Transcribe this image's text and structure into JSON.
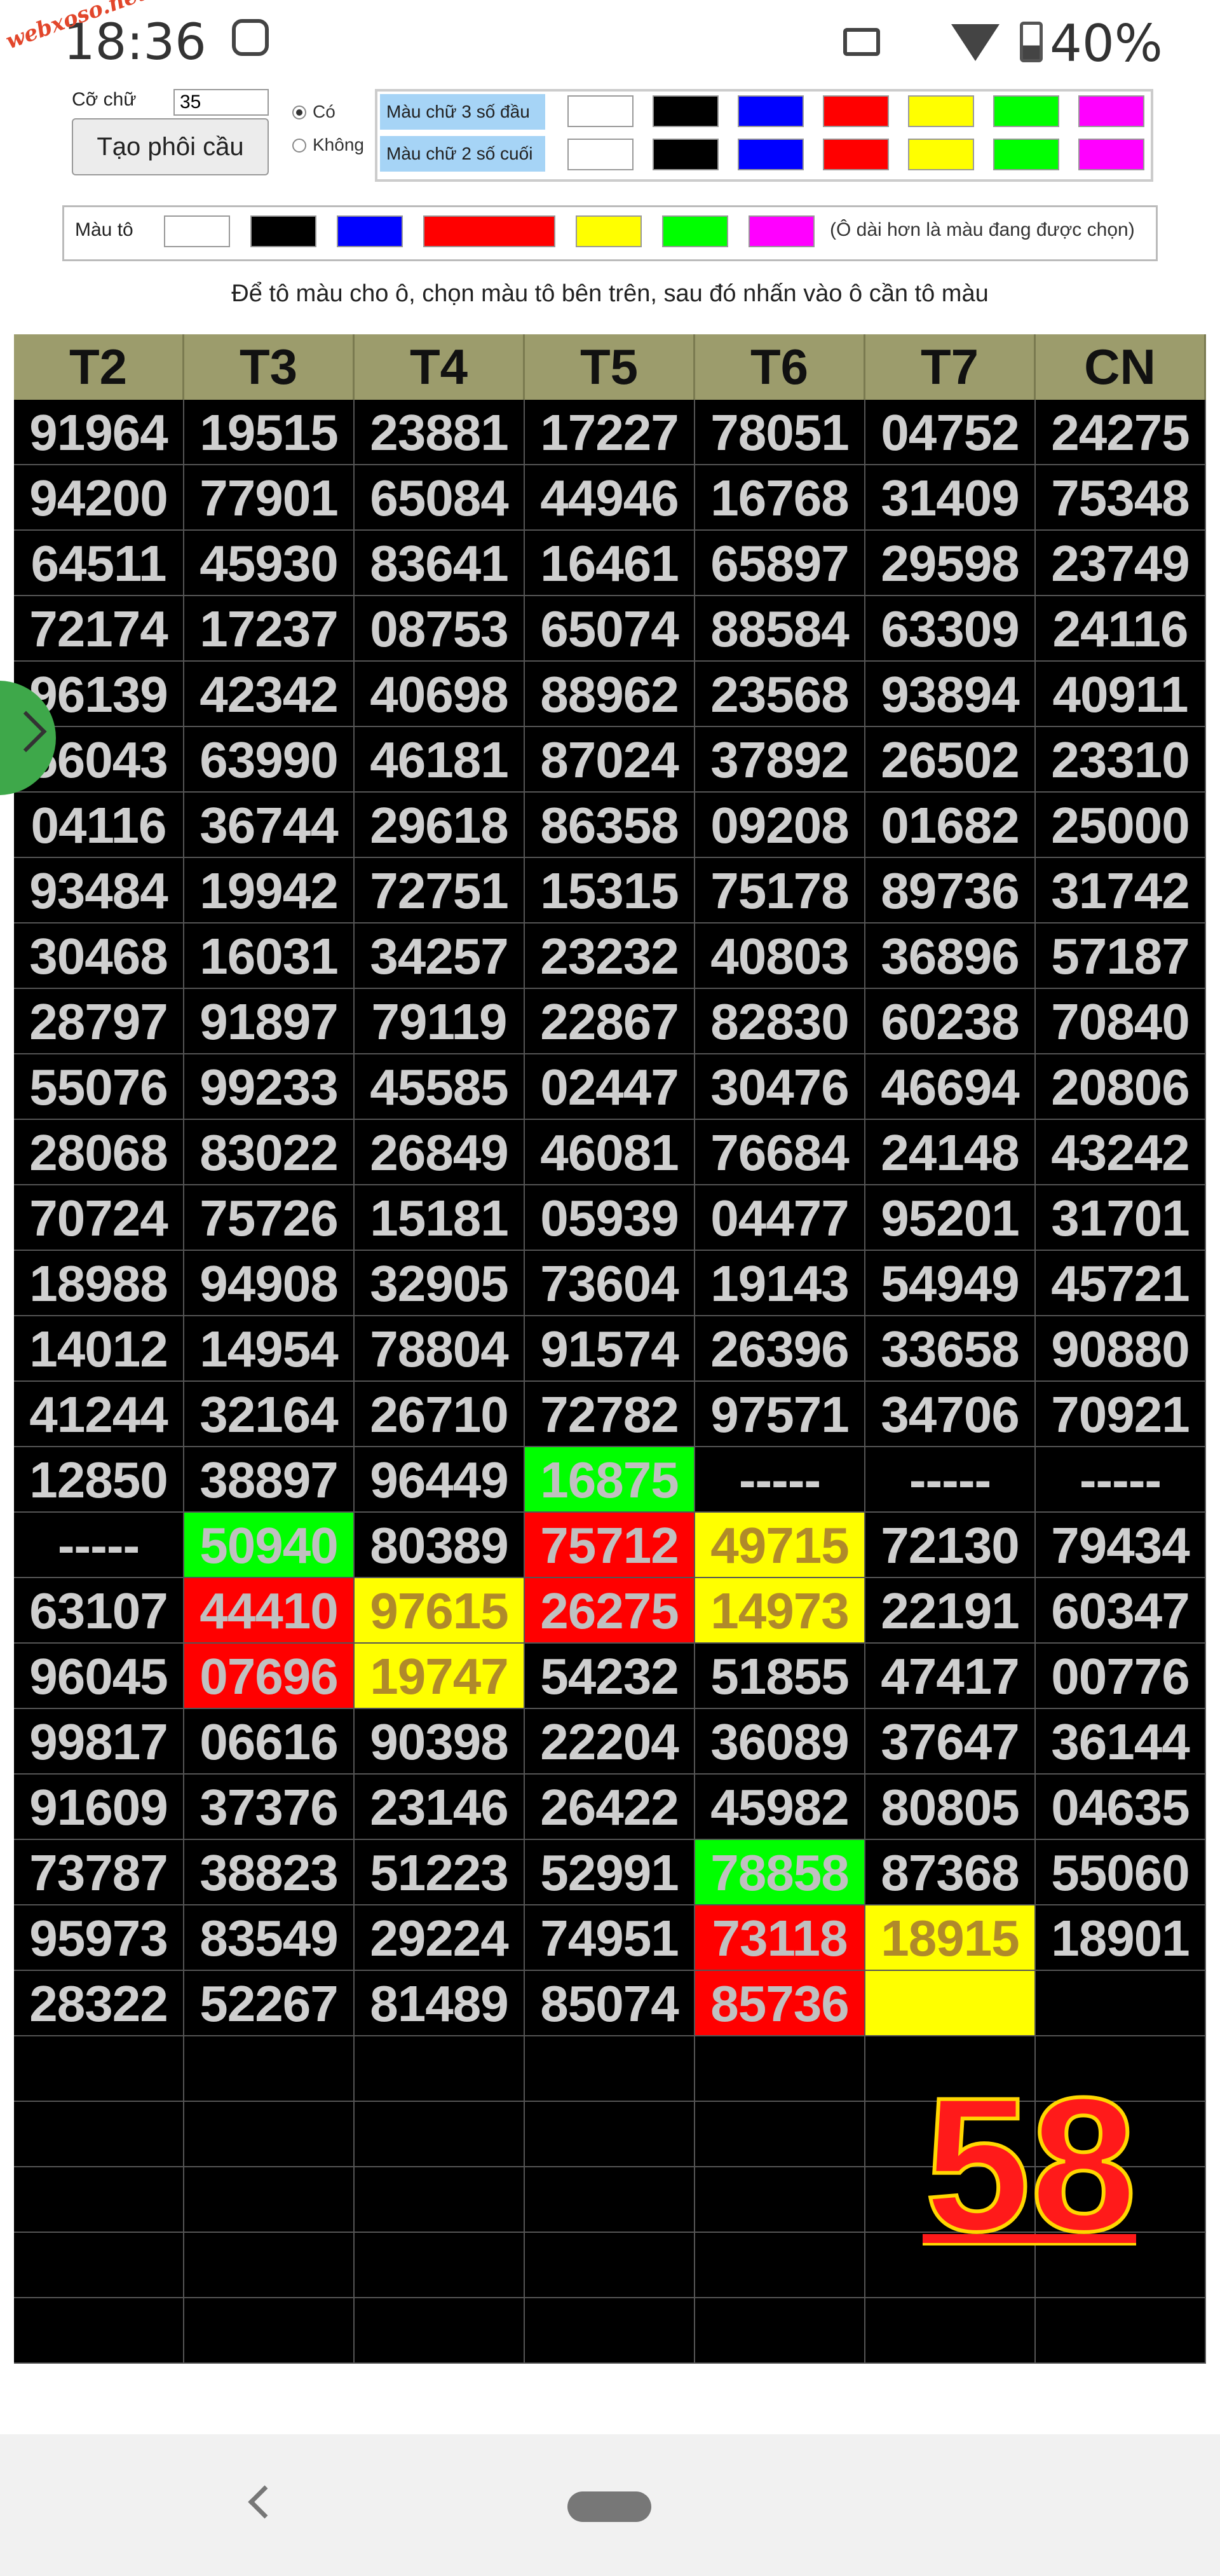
{
  "status_bar": {
    "time": "18:36",
    "watermark": "webxoso.net",
    "battery": "40%"
  },
  "controls": {
    "font_size_label": "Cỡ chữ",
    "font_size_value": "35",
    "create_button": "Tạo phôi cầu",
    "radio_yes": "Có",
    "radio_no": "Không",
    "color_row_1_label": "Màu chữ 3 số đầu",
    "color_row_2_label": "Màu chữ 2 số cuối",
    "fill_label": "Màu tô",
    "fill_note": "(Ô dài hơn là màu đang được chọn)",
    "instruction": "Để tô màu cho ô, chọn màu tô bên trên, sau đó nhấn vào ô cần tô màu",
    "palette": [
      "#ffffff",
      "#000000",
      "#0000ff",
      "#ff0000",
      "#ffff00",
      "#00ff00",
      "#ff00ff"
    ]
  },
  "grid": {
    "headers": [
      "T2",
      "T3",
      "T4",
      "T5",
      "T6",
      "T7",
      "CN"
    ],
    "rows": [
      [
        "91964",
        "19515",
        "23881",
        "17227",
        "78051",
        "04752",
        "24275"
      ],
      [
        "94200",
        "77901",
        "65084",
        "44946",
        "16768",
        "31409",
        "75348"
      ],
      [
        "64511",
        "45930",
        "83641",
        "16461",
        "65897",
        "29598",
        "23749"
      ],
      [
        "72174",
        "17237",
        "08753",
        "65074",
        "88584",
        "63309",
        "24116"
      ],
      [
        "96139",
        "42342",
        "40698",
        "88962",
        "23568",
        "93894",
        "40911"
      ],
      [
        "56043",
        "63990",
        "46181",
        "87024",
        "37892",
        "26502",
        "23310"
      ],
      [
        "04116",
        "36744",
        "29618",
        "86358",
        "09208",
        "01682",
        "25000"
      ],
      [
        "93484",
        "19942",
        "72751",
        "15315",
        "75178",
        "89736",
        "31742"
      ],
      [
        "30468",
        "16031",
        "34257",
        "23232",
        "40803",
        "36896",
        "57187"
      ],
      [
        "28797",
        "91897",
        "79119",
        "22867",
        "82830",
        "60238",
        "70840"
      ],
      [
        "55076",
        "99233",
        "45585",
        "02447",
        "30476",
        "46694",
        "20806"
      ],
      [
        "28068",
        "83022",
        "26849",
        "46081",
        "76684",
        "24148",
        "43242"
      ],
      [
        "70724",
        "75726",
        "15181",
        "05939",
        "04477",
        "95201",
        "31701"
      ],
      [
        "18988",
        "94908",
        "32905",
        "73604",
        "19143",
        "54949",
        "45721"
      ],
      [
        "14012",
        "14954",
        "78804",
        "91574",
        "26396",
        "33658",
        "90880"
      ],
      [
        "41244",
        "32164",
        "26710",
        "72782",
        "97571",
        "34706",
        "70921"
      ],
      [
        "12850",
        "38897",
        "96449",
        "16875",
        "-----",
        "-----",
        "-----"
      ],
      [
        "-----",
        "50940",
        "80389",
        "75712",
        "49715",
        "72130",
        "79434"
      ],
      [
        "63107",
        "44410",
        "97615",
        "26275",
        "14973",
        "22191",
        "60347"
      ],
      [
        "96045",
        "07696",
        "19747",
        "54232",
        "51855",
        "47417",
        "00776"
      ],
      [
        "99817",
        "06616",
        "90398",
        "22204",
        "36089",
        "37647",
        "36144"
      ],
      [
        "91609",
        "37376",
        "23146",
        "26422",
        "45982",
        "80805",
        "04635"
      ],
      [
        "73787",
        "38823",
        "51223",
        "52991",
        "78858",
        "87368",
        "55060"
      ],
      [
        "95973",
        "83549",
        "29224",
        "74951",
        "73118",
        "18915",
        "18901"
      ],
      [
        "28322",
        "52267",
        "81489",
        "85074",
        "85736",
        "",
        ""
      ],
      [
        "",
        "",
        "",
        "",
        "",
        "",
        ""
      ],
      [
        "",
        "",
        "",
        "",
        "",
        "",
        ""
      ],
      [
        "",
        "",
        "",
        "",
        "",
        "",
        ""
      ],
      [
        "",
        "",
        "",
        "",
        "",
        "",
        ""
      ],
      [
        "",
        "",
        "",
        "",
        "",
        "",
        ""
      ]
    ],
    "highlights": [
      {
        "row": 16,
        "col": 3,
        "color": "#00ff00"
      },
      {
        "row": 17,
        "col": 1,
        "color": "#00ff00"
      },
      {
        "row": 17,
        "col": 3,
        "color": "#ff0000"
      },
      {
        "row": 17,
        "col": 4,
        "color": "#ffff00"
      },
      {
        "row": 18,
        "col": 1,
        "color": "#ff0000"
      },
      {
        "row": 18,
        "col": 2,
        "color": "#ffff00"
      },
      {
        "row": 18,
        "col": 3,
        "color": "#ff0000"
      },
      {
        "row": 18,
        "col": 4,
        "color": "#ffff00"
      },
      {
        "row": 19,
        "col": 1,
        "color": "#ff0000"
      },
      {
        "row": 19,
        "col": 2,
        "color": "#ffff00"
      },
      {
        "row": 22,
        "col": 4,
        "color": "#00ff00"
      },
      {
        "row": 23,
        "col": 4,
        "color": "#ff0000"
      },
      {
        "row": 23,
        "col": 5,
        "color": "#ffff00"
      },
      {
        "row": 24,
        "col": 4,
        "color": "#ff0000"
      },
      {
        "row": 24,
        "col": 5,
        "color": "#ffff00"
      }
    ]
  },
  "count_label": "58"
}
